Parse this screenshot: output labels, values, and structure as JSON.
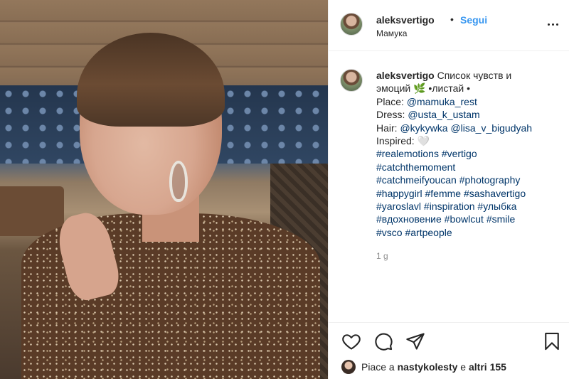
{
  "post": {
    "username": "aleksvertigo",
    "separator": "•",
    "follow_label": "Segui",
    "location": "Мамука"
  },
  "caption": {
    "username": "aleksvertigo",
    "line1_text": " Список чувств и",
    "line2_text": "эмоций 🌿 •листай •",
    "place_label": "Place: ",
    "place_mention": "@mamuka_rest",
    "dress_label": "Dress: ",
    "dress_mention": "@usta_k_ustam",
    "hair_label": "Hair: ",
    "hair_mention_1": "@kykywka",
    "hair_mention_2": "@lisa_v_bigudyah",
    "inspired_label": "Inspired: 🤍",
    "hashtag_lines": [
      "#realemotions #vertigo",
      "#catchthemoment",
      "#catchmeifyoucan #photography",
      "#happygirl #femme #sashavertigo",
      "#yaroslavl #inspiration #улыбка",
      "#вдохновение #bowlcut #smile",
      "#vsco #artpeople"
    ],
    "timestamp": "1 g"
  },
  "actions": {
    "like_icon": "heart-icon",
    "comment_icon": "comment-icon",
    "share_icon": "paper-plane-icon",
    "save_icon": "bookmark-icon"
  },
  "likes": {
    "prefix": "Piace a ",
    "liker": "nastykolesty",
    "conj": " e ",
    "others": "altri 155"
  },
  "colors": {
    "link": "#003569",
    "follow": "#3897f0",
    "text": "#262626",
    "muted": "#8e8e8e"
  }
}
